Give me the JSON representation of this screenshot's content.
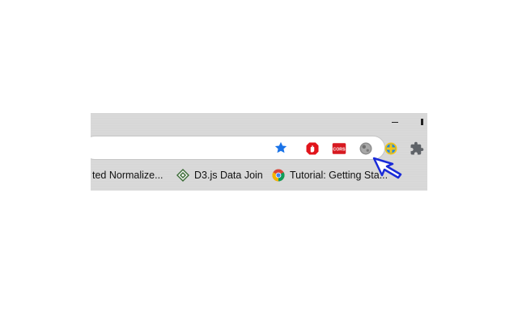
{
  "toolbar": {
    "bookmark_star": "star-icon",
    "extensions": [
      {
        "name": "adblock-extension",
        "label": ""
      },
      {
        "name": "cors-extension",
        "label": "CORS"
      },
      {
        "name": "moon-extension",
        "label": ""
      },
      {
        "name": "plus-extension",
        "label": ""
      },
      {
        "name": "extensions-puzzle",
        "label": ""
      }
    ]
  },
  "bookmarks": [
    {
      "label": "ted Normalize...",
      "icon": "none"
    },
    {
      "label": "D3.js Data Join",
      "icon": "d3-icon"
    },
    {
      "label": "Tutorial: Getting Sta...",
      "icon": "chrome-icon"
    }
  ],
  "colors": {
    "star": "#1a73e8",
    "adblock_red": "#e1141b",
    "cors_red": "#d71920",
    "cursor_blue": "#1a2bd8"
  }
}
